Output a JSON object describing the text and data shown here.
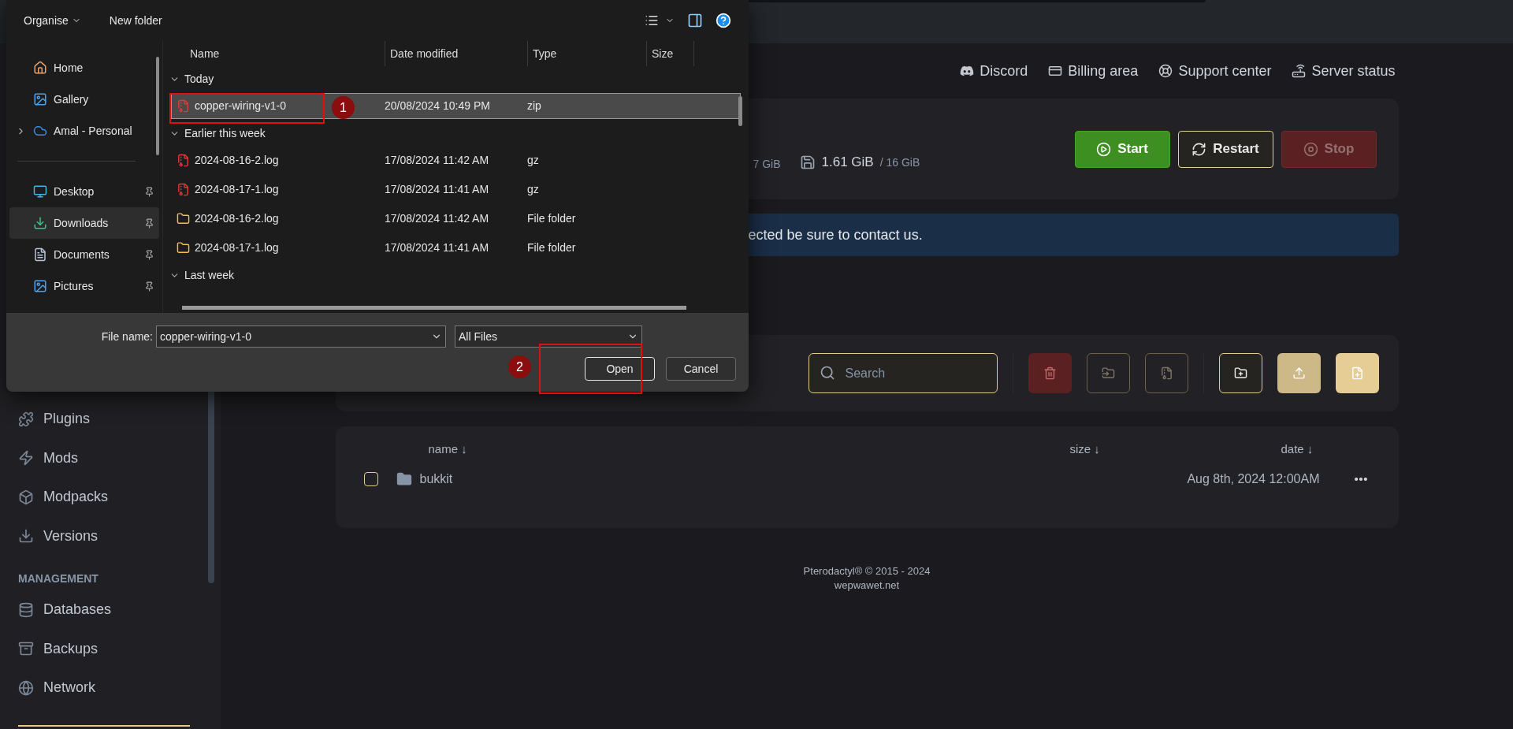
{
  "dialog": {
    "toolbar": {
      "organise": "Organise",
      "new_folder": "New folder"
    },
    "nav": [
      {
        "label": "Home",
        "kind": "home",
        "pinned": false,
        "selected": false,
        "expandable": false
      },
      {
        "label": "Gallery",
        "kind": "gallery",
        "pinned": false,
        "selected": false,
        "expandable": false
      },
      {
        "label": "Amal - Personal",
        "kind": "cloud",
        "pinned": false,
        "selected": false,
        "expandable": true
      },
      {
        "label": "Desktop",
        "kind": "desktop",
        "pinned": true,
        "selected": false,
        "expandable": false
      },
      {
        "label": "Downloads",
        "kind": "downloads",
        "pinned": true,
        "selected": true,
        "expandable": false
      },
      {
        "label": "Documents",
        "kind": "documents",
        "pinned": true,
        "selected": false,
        "expandable": false
      },
      {
        "label": "Pictures",
        "kind": "pictures",
        "pinned": true,
        "selected": false,
        "expandable": false
      }
    ],
    "columns": [
      "Name",
      "Date modified",
      "Type",
      "Size"
    ],
    "groups": [
      {
        "label": "Today",
        "expanded": true,
        "files": [
          {
            "name": "copper-wiring-v1-0",
            "date": "20/08/2024 10:49 PM",
            "type": "zip",
            "kind": "archive",
            "selected": true
          }
        ]
      },
      {
        "label": "Earlier this week",
        "expanded": true,
        "files": [
          {
            "name": "2024-08-16-2.log",
            "date": "17/08/2024 11:42 AM",
            "type": "gz",
            "kind": "archive",
            "selected": false
          },
          {
            "name": "2024-08-17-1.log",
            "date": "17/08/2024 11:41 AM",
            "type": "gz",
            "kind": "archive",
            "selected": false
          },
          {
            "name": "2024-08-16-2.log",
            "date": "17/08/2024 11:42 AM",
            "type": "File folder",
            "kind": "folder",
            "selected": false
          },
          {
            "name": "2024-08-17-1.log",
            "date": "17/08/2024 11:41 AM",
            "type": "File folder",
            "kind": "folder",
            "selected": false
          }
        ]
      },
      {
        "label": "Last week",
        "expanded": true
      }
    ],
    "file_name": {
      "label": "File name:",
      "value": "copper-wiring-v1-0"
    },
    "filter": "All Files",
    "buttons": [
      "Open",
      "Cancel"
    ],
    "annotations": [
      "1",
      "2"
    ]
  },
  "top_links": [
    "Discord",
    "Billing area",
    "Support center",
    "Server status"
  ],
  "server": {
    "stats": [
      {
        "limit": "7 GiB"
      },
      {
        "value": "1.61 GiB",
        "limit": "/ 16 GiB"
      }
    ],
    "buttons": [
      {
        "label": "Start",
        "kind": "start",
        "disabled": false
      },
      {
        "label": "Restart",
        "kind": "restart",
        "disabled": false
      },
      {
        "label": "Stop",
        "kind": "stop",
        "disabled": true
      }
    ]
  },
  "alert": "ected be sure to contact us.",
  "toolbar": {
    "search_placeholder": "Search",
    "actions": [
      {
        "kind": "delete"
      },
      {
        "kind": "move"
      },
      {
        "kind": "archive"
      },
      {
        "kind": "new-folder"
      },
      {
        "kind": "upload"
      },
      {
        "kind": "new-file"
      }
    ]
  },
  "files": {
    "columns": [
      "name ↓",
      "size ↓",
      "date ↓"
    ],
    "rows": [
      {
        "name": "bukkit",
        "date": "Aug 8th, 2024 12:00AM",
        "checked": false
      }
    ]
  },
  "footer": [
    "Pterodactyl® © 2015 - 2024",
    "wepwawet.net"
  ],
  "sidebar": [
    {
      "kind": "item",
      "label": "Plugins"
    },
    {
      "kind": "item",
      "label": "Mods"
    },
    {
      "kind": "item",
      "label": "Modpacks"
    },
    {
      "kind": "item",
      "label": "Versions"
    },
    {
      "kind": "heading",
      "label": "MANAGEMENT"
    },
    {
      "kind": "item",
      "label": "Databases"
    },
    {
      "kind": "item",
      "label": "Backups"
    },
    {
      "kind": "item",
      "label": "Network"
    }
  ]
}
